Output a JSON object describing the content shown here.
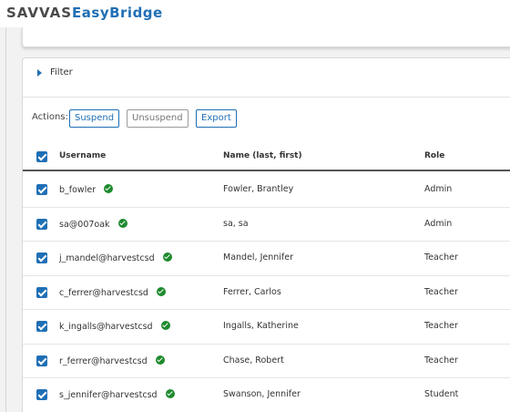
{
  "header": {
    "brand": "SAVVAS",
    "product": "EasyBridge"
  },
  "filter": {
    "label": "Filter"
  },
  "actions": {
    "label": "Actions:",
    "suspend": "Suspend",
    "unsuspend": "Unsuspend",
    "export": "Export"
  },
  "table": {
    "columns": {
      "username": "Username",
      "name": "Name (last, first)",
      "role": "Role"
    },
    "rows": [
      {
        "username": "b_fowler",
        "name": "Fowler, Brantley",
        "role": "Admin"
      },
      {
        "username": "sa@007oak",
        "name": "sa, sa",
        "role": "Admin"
      },
      {
        "username": "j_mandel@harvestcsd",
        "name": "Mandel, Jennifer",
        "role": "Teacher"
      },
      {
        "username": "c_ferrer@harvestcsd",
        "name": "Ferrer, Carlos",
        "role": "Teacher"
      },
      {
        "username": "k_ingalls@harvestcsd",
        "name": "Ingalls, Katherine",
        "role": "Teacher"
      },
      {
        "username": "r_ferrer@harvestcsd",
        "name": "Chase, Robert",
        "role": "Teacher"
      },
      {
        "username": "s_jennifer@harvestcsd",
        "name": "Swanson, Jennifer",
        "role": "Student"
      }
    ]
  },
  "colors": {
    "accent": "#1f6fb5",
    "active_status": "#1e8a2e",
    "brand_gray": "#4a4a4a"
  },
  "icons": {
    "filter_toggle": "caret-right-icon",
    "status": "check-circle-icon",
    "select": "checkbox-checked-icon"
  }
}
